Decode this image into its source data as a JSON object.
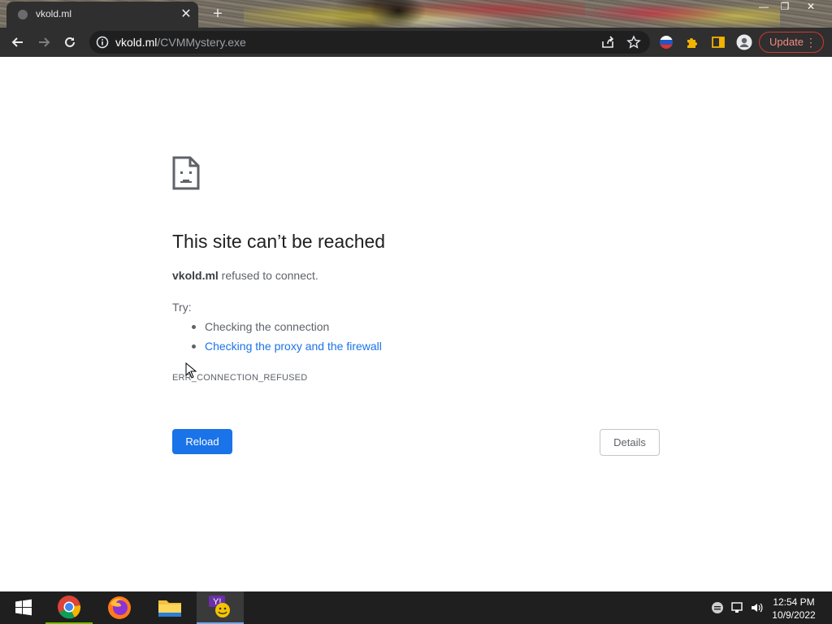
{
  "browser": {
    "tab": {
      "title": "vkold.ml"
    },
    "address": {
      "host": "vkold.ml",
      "path": "/CVMMystery.exe"
    },
    "update_label": "Update",
    "accent_color": "#1a73e8",
    "update_color": "#d3382d"
  },
  "error": {
    "title": "This site can’t be reached",
    "host": "vkold.ml",
    "summary_rest": " refused to connect.",
    "try_label": "Try:",
    "suggestions": [
      "Checking the connection",
      "Checking the proxy and the firewall"
    ],
    "code": "ERR_CONNECTION_REFUSED",
    "reload_label": "Reload",
    "details_label": "Details"
  },
  "taskbar": {
    "apps": [
      "start-icon",
      "chrome-icon",
      "firefox-icon",
      "file-explorer-icon",
      "yahoo-messenger-icon"
    ],
    "tray_icons": [
      "notification-icon",
      "network-icon",
      "volume-icon"
    ],
    "time": "12:54 PM",
    "date": "10/9/2022"
  }
}
